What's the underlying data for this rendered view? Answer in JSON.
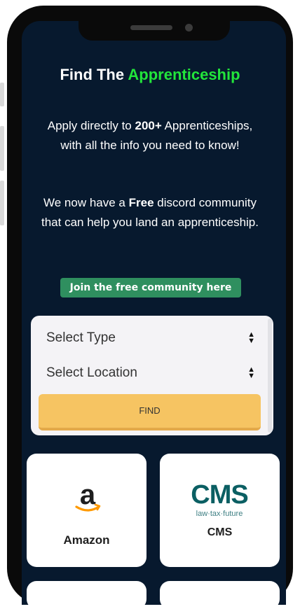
{
  "hero": {
    "title_prefix": "Find The ",
    "title_accent": "Apprenticeship",
    "p1_a": "Apply directly to ",
    "p1_bold": "200+",
    "p1_b": " Apprenticeships, with all the info you need to know!",
    "p2_a": "We now have a ",
    "p2_bold": "Free",
    "p2_b": " discord community that can help you land an apprenticeship."
  },
  "community_button": "Join the free community here",
  "search": {
    "type_placeholder": "Select Type",
    "location_placeholder": "Select Location",
    "find_label": "FIND"
  },
  "companies": [
    {
      "name": "Amazon",
      "logo": "amazon-logo"
    },
    {
      "name": "CMS",
      "logo_text": "CMS",
      "tagline": "law·tax·future"
    }
  ],
  "colors": {
    "background": "#07192e",
    "accent": "#22e53b",
    "community_button": "#2f8f5f",
    "find_button": "#f6c462"
  }
}
